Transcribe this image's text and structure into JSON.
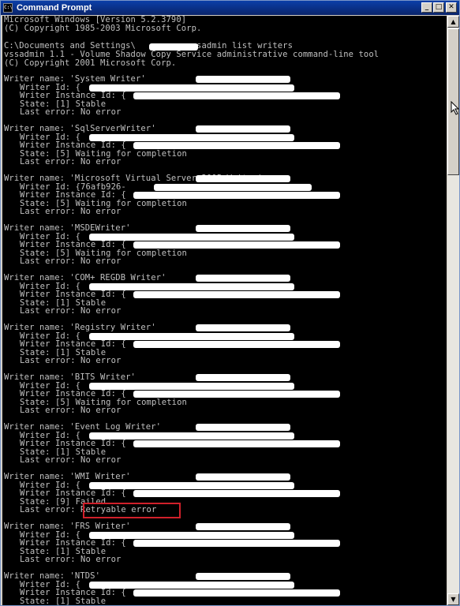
{
  "window": {
    "title": "Command Prompt",
    "app_icon": "C:\\",
    "minimize": "_",
    "maximize": "□",
    "close": "✕",
    "scroll_up": "▲",
    "scroll_down": "▼"
  },
  "header_lines": [
    "Microsoft Windows [Version 5.2.3790]",
    "(C) Copyright 1985-2003 Microsoft Corp.",
    "",
    "C:\\Documents and Settings\\         >vssadmin list writers",
    "vssadmin 1.1 - Volume Shadow Copy Service administrative command-line tool",
    "(C) Copyright 2001 Microsoft Corp."
  ],
  "labels": {
    "writer_name": "Writer name:",
    "writer_id": "Writer Id:",
    "instance_id": "Writer Instance Id:",
    "state": "State:",
    "last_error": "Last error:"
  },
  "writers": [
    {
      "name": "Writer name: 'System Writer'",
      "id": "Writer Id: {",
      "instance": "Writer Instance Id: {",
      "state": "State: [1] Stable",
      "error": "Last error: No error"
    },
    {
      "name": "Writer name: 'SqlServerWriter'",
      "id": "Writer Id: {",
      "instance": "Writer Instance Id: {",
      "state": "State: [5] Waiting for completion",
      "error": "Last error: No error"
    },
    {
      "name": "Writer name: 'Microsoft Virtual Server 2005 Writer'",
      "id": "Writer Id: {76afb926-",
      "instance": "Writer Instance Id: {",
      "state": "State: [5] Waiting for completion",
      "error": "Last error: No error"
    },
    {
      "name": "Writer name: 'MSDEWriter'",
      "id": "Writer Id: {",
      "instance": "Writer Instance Id: {",
      "state": "State: [5] Waiting for completion",
      "error": "Last error: No error"
    },
    {
      "name": "Writer name: 'COM+ REGDB Writer'",
      "id": "Writer Id: {",
      "instance": "Writer Instance Id: {",
      "state": "State: [1] Stable",
      "error": "Last error: No error"
    },
    {
      "name": "Writer name: 'Registry Writer'",
      "id": "Writer Id: {",
      "instance": "Writer Instance Id: {",
      "state": "State: [1] Stable",
      "error": "Last error: No error"
    },
    {
      "name": "Writer name: 'BITS Writer'",
      "id": "Writer Id: {",
      "instance": "Writer Instance Id: {",
      "state": "State: [5] Waiting for completion",
      "error": "Last error: No error"
    },
    {
      "name": "Writer name: 'Event Log Writer'",
      "id": "Writer Id: {",
      "instance": "Writer Instance Id: {",
      "state": "State: [1] Stable",
      "error": "Last error: No error"
    },
    {
      "name": "Writer name: 'WMI Writer'",
      "id": "Writer Id: {",
      "instance": "Writer Instance Id: {",
      "state": "State: [9] Failed",
      "error": "Last error: Retryable error"
    },
    {
      "name": "Writer name: 'FRS Writer'",
      "id": "Writer Id: {",
      "instance": "Writer Instance Id: {",
      "state": "State: [1] Stable",
      "error": "Last error: No error"
    },
    {
      "name": "Writer name: 'NTDS'",
      "id": "Writer Id: {",
      "instance": "Writer Instance Id: {",
      "state": "State: [1] Stable",
      "error": ""
    }
  ],
  "colors": {
    "console_bg": "#000000",
    "console_text": "#c0c0c0",
    "title_bg": "#0a246a",
    "highlight": "#d0202a"
  }
}
